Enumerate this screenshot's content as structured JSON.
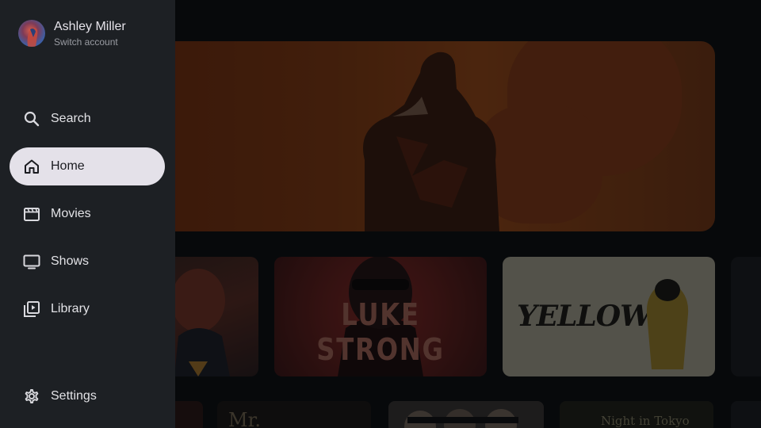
{
  "account": {
    "name": "Ashley Miller",
    "subtitle": "Switch account"
  },
  "nav": {
    "items": [
      {
        "label": "Search",
        "icon": "search-icon",
        "active": false
      },
      {
        "label": "Home",
        "icon": "home-icon",
        "active": true
      },
      {
        "label": "Movies",
        "icon": "movie-icon",
        "active": false
      },
      {
        "label": "Shows",
        "icon": "tv-icon",
        "active": false
      },
      {
        "label": "Library",
        "icon": "library-icon",
        "active": false
      }
    ],
    "settings_label": "Settings",
    "settings_icon": "gear-icon"
  },
  "content": {
    "cards": [
      {
        "title": ""
      },
      {
        "title": "LUKE STRONG"
      },
      {
        "title": "YELLOW"
      },
      {
        "title": ""
      }
    ],
    "thumbs": [
      {
        "title": ""
      },
      {
        "title": "Mr."
      },
      {
        "title": ""
      },
      {
        "title": "Night in Tokyo"
      },
      {
        "title": ""
      }
    ]
  },
  "colors": {
    "drawer_bg": "#1d2024",
    "active_pill": "#e4e1e9",
    "hero_orange": "#8a3b10"
  }
}
